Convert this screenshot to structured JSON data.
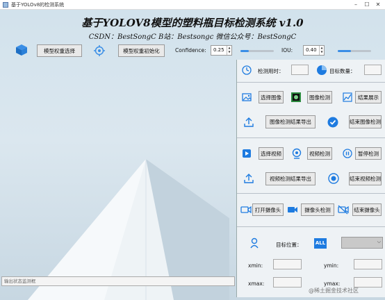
{
  "window": {
    "title": "基于YOLOv8的检测系统"
  },
  "header": {
    "title": "基于YOLOV8模型的塑料瓶目标检测系统 v1.0",
    "subtitle": "CSDN：BestSongC   B站：Bestsongc   微信公众号：BestSongC"
  },
  "toolbar": {
    "model_select": "模型权重选择",
    "model_init": "模型权重初始化",
    "confidence_label": "Confidence:",
    "confidence_value": "0.25",
    "confidence_level": 0.25,
    "iou_label": "IOU:",
    "iou_value": "0.40",
    "iou_level": 0.4
  },
  "panel": {
    "time_label": "检测用时：",
    "count_label": "目标数量：",
    "select_image": "选择图像",
    "detect_image": "图像检测",
    "show_result": "结果展示",
    "export_image": "图像检测结果导出",
    "end_image": "结束图像检测",
    "select_video": "选择视频",
    "detect_video": "视频检测",
    "pause_detect": "暂停检测",
    "export_video": "视频检测结果导出",
    "end_video": "结束视频检测",
    "open_camera": "打开摄像头",
    "detect_camera": "摄像头检测",
    "end_camera": "结束摄像头",
    "target_position": "目标位置：",
    "all_badge": "ALL",
    "xmin": "xmin:",
    "ymin": "ymin:",
    "xmax": "xmax:",
    "ymax": "ymax:"
  },
  "status": {
    "placeholder": "输出状态监测框"
  },
  "watermark": "@稀土掘金技术社区",
  "colors": {
    "accent": "#1e7be0",
    "panel_bg": "#eef2f5"
  }
}
